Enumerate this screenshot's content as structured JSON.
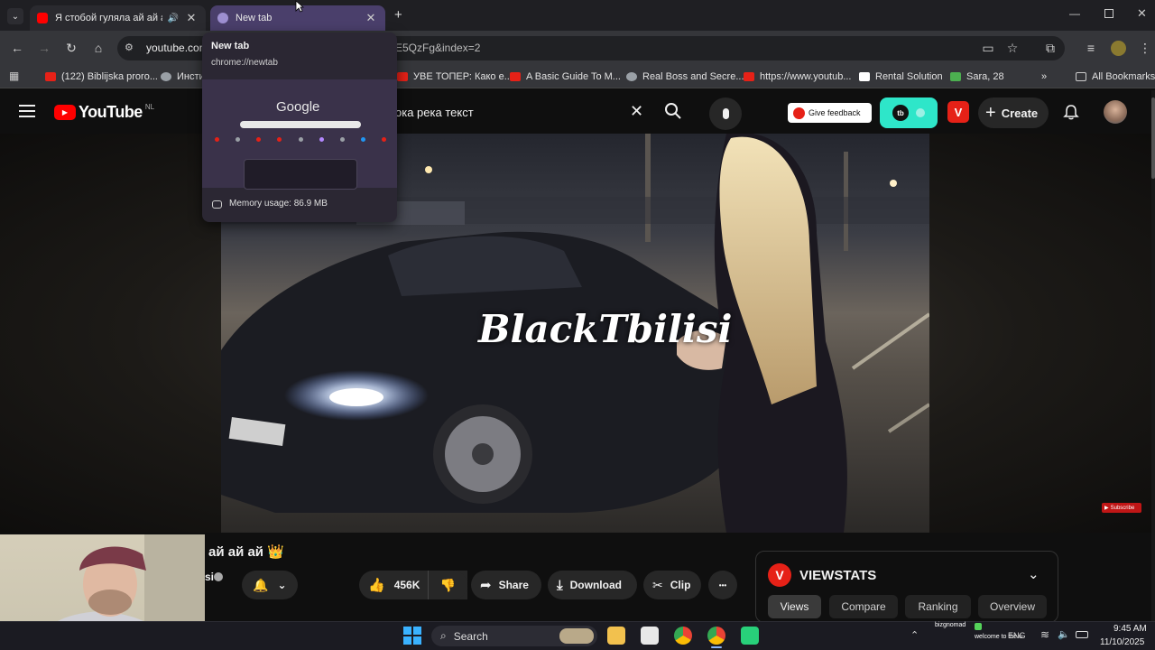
{
  "tabs": [
    {
      "title": "Я стобой гуляла ай ай ай",
      "active": false
    },
    {
      "title": "New tab",
      "active": true
    }
  ],
  "tab_preview": {
    "title": "New tab",
    "url": "chrome://newtab",
    "thumb_brand": "Google",
    "memory": "Memory usage: 86.9 MB"
  },
  "toolbar": {
    "url_host": "youtube.com",
    "url_tail": "E5QzFg&index=2"
  },
  "bookmarks": [
    {
      "label": "(122) Biblijska proro...",
      "color": "#e62117"
    },
    {
      "label": "Инсти",
      "color": "#9aa0a6"
    },
    {
      "label": "УВЕ ТОПЕР: Како е...",
      "color": "#e62117"
    },
    {
      "label": "A Basic Guide To M...",
      "color": "#e62117"
    },
    {
      "label": "Real Boss and Secre...",
      "color": "#9aa0a6"
    },
    {
      "label": "https://www.youtub...",
      "color": "#e62117"
    },
    {
      "label": "Rental Solution",
      "color": "#ffffff"
    },
    {
      "label": "Sara, 28",
      "color": "#4caf50"
    }
  ],
  "bookmarks_more": "»",
  "all_bookmarks": "All Bookmarks",
  "youtube": {
    "logo": "YouTube",
    "region": "NL",
    "search_value": "ока река текст",
    "feedback": "Give feedback",
    "create": "Create"
  },
  "video": {
    "watermark": "BlackTbilisi",
    "subscribe_badge": "Subscribe"
  },
  "below": {
    "title_fragment": "ай ай ай 👑",
    "channel_fragment": "si",
    "likes": "456K",
    "share": "Share",
    "download": "Download",
    "clip": "Clip",
    "more": "•••"
  },
  "viewstats": {
    "name": "VIEWSTATS",
    "tabs": [
      "Views",
      "Compare",
      "Ranking",
      "Overview"
    ]
  },
  "taskbar": {
    "search": "Search",
    "lang": "ENG",
    "time": "9:45 AM",
    "date": "11/10/2025",
    "notif_1": "bizgnomad",
    "notif_2": "welcome to the u"
  },
  "colors": {
    "accent_tab": "#4a3f6b",
    "youtube_red": "#ff0000",
    "teal": "#2ee6c9"
  }
}
